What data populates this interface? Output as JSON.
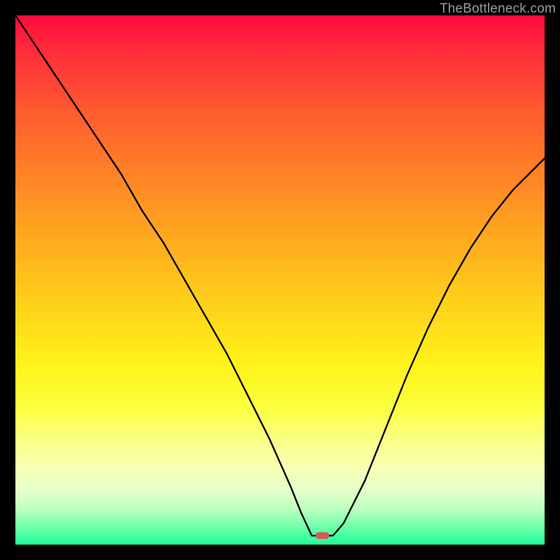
{
  "watermark": "TheBottleneck.com",
  "chart_data": {
    "type": "line",
    "title": "",
    "xlabel": "",
    "ylabel": "",
    "xlim": [
      0,
      100
    ],
    "ylim": [
      0,
      100
    ],
    "series": [
      {
        "name": "bottleneck-curve",
        "x": [
          0,
          4,
          8,
          12,
          16,
          20,
          24,
          28,
          32,
          36,
          40,
          44,
          48,
          52,
          54,
          56,
          58,
          60,
          62,
          66,
          70,
          74,
          78,
          82,
          86,
          90,
          94,
          98,
          100
        ],
        "values": [
          100,
          94,
          88,
          82,
          76,
          70,
          63,
          57,
          50,
          43,
          36,
          28,
          20,
          11,
          6,
          1.7,
          1.7,
          1.7,
          4,
          12,
          22,
          32,
          41,
          49,
          56,
          62,
          67,
          71,
          73
        ]
      }
    ],
    "marker": {
      "x": 58,
      "y": 1.7,
      "shape": "pill",
      "color": "#d15a5a"
    },
    "background_gradient": {
      "top_color": "#ff0a3e",
      "bottom_color": "#1eff9a",
      "description": "vertical red-to-green heat gradient"
    },
    "grid": false,
    "legend": false
  }
}
